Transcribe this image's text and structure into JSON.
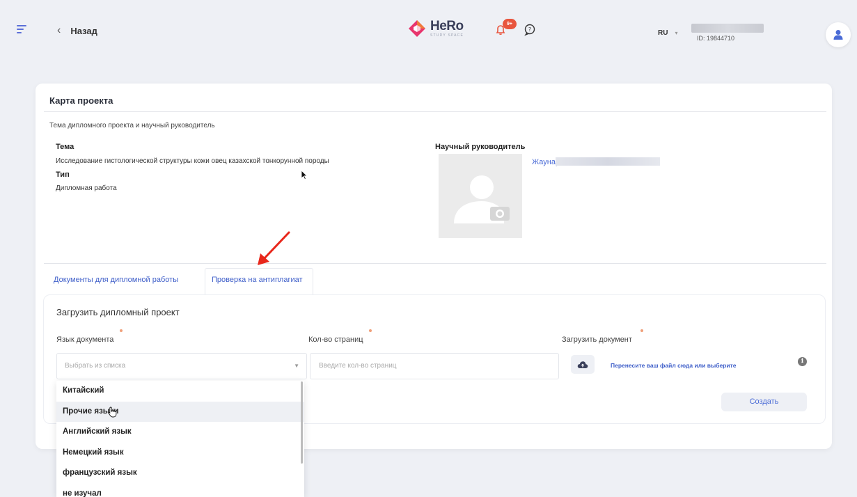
{
  "header": {
    "back_label": "Назад",
    "logo_main": "HeRo",
    "logo_sub": "STUDY SPACE",
    "notifications_badge": "9+",
    "lang": "RU",
    "user_id": "ID: 19844710",
    "accent": "#4a6bd6",
    "badge_color": "#e8553e"
  },
  "card": {
    "title": "Карта проекта",
    "subtitle": "Тема дипломного проекта и научный руководитель",
    "topic_label": "Тема",
    "topic_value": "Исследование гистологической структуры кожи овец казахской тонкорунной породы",
    "type_label": "Тип",
    "type_value": "Дипломная работа",
    "supervisor_label": "Научный руководитель",
    "supervisor_name": "Жаунар"
  },
  "tabs": [
    {
      "label": "Документы для дипломной работы",
      "active": false
    },
    {
      "label": "Проверка на антиплагиат",
      "active": true
    }
  ],
  "upload": {
    "title": "Загрузить дипломный проект",
    "language_label": "Язык документа",
    "language_placeholder": "Выбрать из списка",
    "pages_label": "Кол-во страниц",
    "pages_placeholder": "Введите кол-во страниц",
    "document_label": "Загрузить документ",
    "drop_text": "Перенесите ваш файл сюда или выберите",
    "create_label": "Создать"
  },
  "dropdown": {
    "options": [
      "Китайский",
      "Прочие языки",
      "Английский язык",
      "Немецкий язык",
      "французский язык",
      "не изучал"
    ],
    "hovered_index": 1
  }
}
